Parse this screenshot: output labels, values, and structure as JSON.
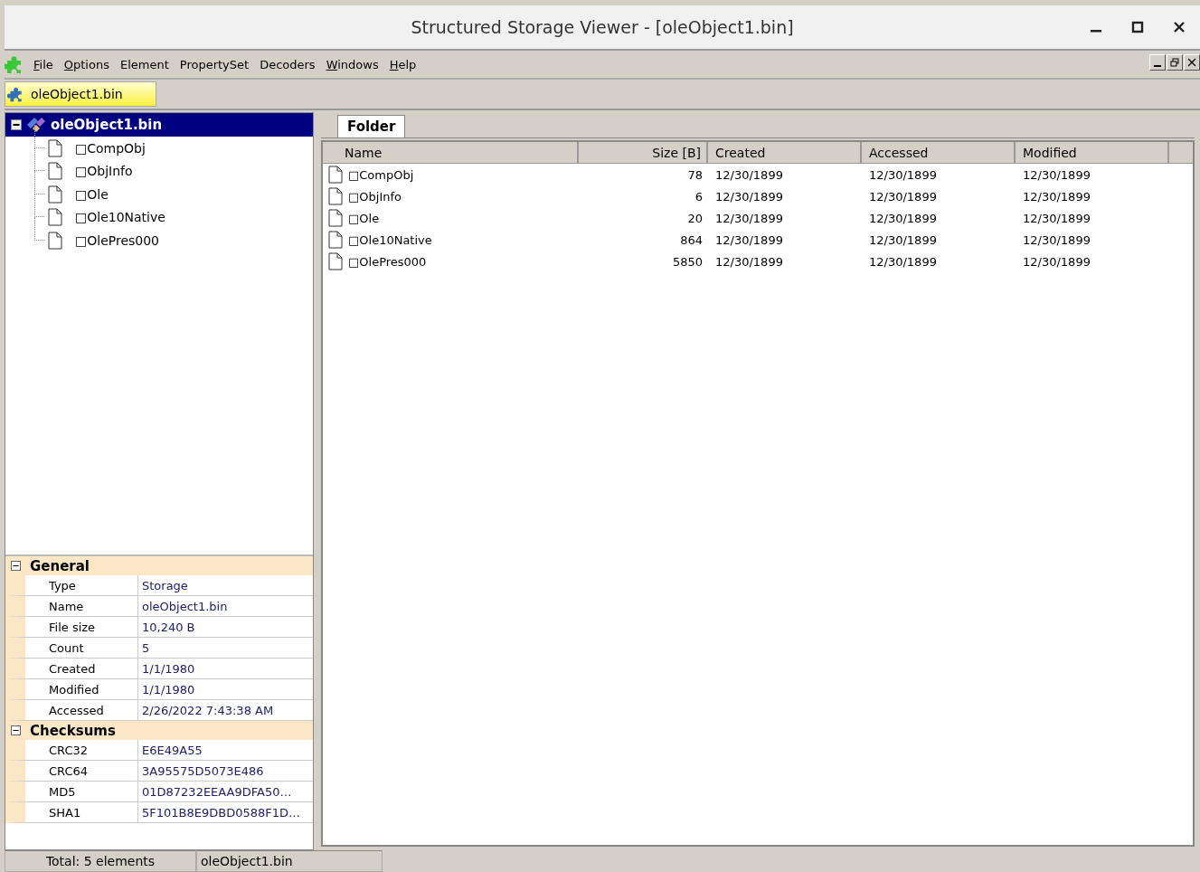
{
  "window": {
    "title": "Structured Storage Viewer - [oleObject1.bin]"
  },
  "menu": [
    {
      "label": "File",
      "underline_first": true
    },
    {
      "label": "Options",
      "underline_first": true
    },
    {
      "label": "Element",
      "underline_first": false
    },
    {
      "label": "PropertySet",
      "underline_first": false
    },
    {
      "label": "Decoders",
      "underline_first": false
    },
    {
      "label": "Windows",
      "underline_first": true
    },
    {
      "label": "Help",
      "underline_first": true
    }
  ],
  "document_tabs": [
    {
      "label": "oleObject1.bin",
      "selected": true
    }
  ],
  "tree": {
    "label": "oleObject1.bin",
    "selected": true,
    "expanded": true,
    "children": [
      {
        "label": "□CompObj"
      },
      {
        "label": "□ObjInfo"
      },
      {
        "label": "□Ole"
      },
      {
        "label": "□Ole10Native"
      },
      {
        "label": "□OlePres000"
      }
    ]
  },
  "properties": [
    {
      "title": "General",
      "expanded": true,
      "rows": [
        [
          "Type",
          "Storage"
        ],
        [
          "Name",
          "oleObject1.bin"
        ],
        [
          "File size",
          "10,240 B"
        ],
        [
          "Count",
          "5"
        ],
        [
          "Created",
          "1/1/1980"
        ],
        [
          "Modified",
          "1/1/1980"
        ],
        [
          "Accessed",
          "2/26/2022 7:43:38 AM"
        ]
      ]
    },
    {
      "title": "Checksums",
      "expanded": true,
      "rows": [
        [
          "CRC32",
          "E6E49A55"
        ],
        [
          "CRC64",
          "3A95575D5073E486"
        ],
        [
          "MD5",
          "01D87232EEAA9DFA50…"
        ],
        [
          "SHA1",
          "5F101B8E9DBD0588F1D…"
        ]
      ]
    }
  ],
  "view_tabs": [
    {
      "label": "Folder",
      "selected": true
    }
  ],
  "table": {
    "columns": [
      "Name",
      "Size [B]",
      "Created",
      "Accessed",
      "Modified"
    ],
    "rows": [
      [
        "□CompObj",
        "78",
        "12/30/1899",
        "12/30/1899",
        "12/30/1899"
      ],
      [
        "□ObjInfo",
        "6",
        "12/30/1899",
        "12/30/1899",
        "12/30/1899"
      ],
      [
        "□Ole",
        "20",
        "12/30/1899",
        "12/30/1899",
        "12/30/1899"
      ],
      [
        "□Ole10Native",
        "864",
        "12/30/1899",
        "12/30/1899",
        "12/30/1899"
      ],
      [
        "□OlePres000",
        "5850",
        "12/30/1899",
        "12/30/1899",
        "12/30/1899"
      ]
    ]
  },
  "status_bar": [
    "Total: 5 elements",
    "oleObject1.bin"
  ]
}
